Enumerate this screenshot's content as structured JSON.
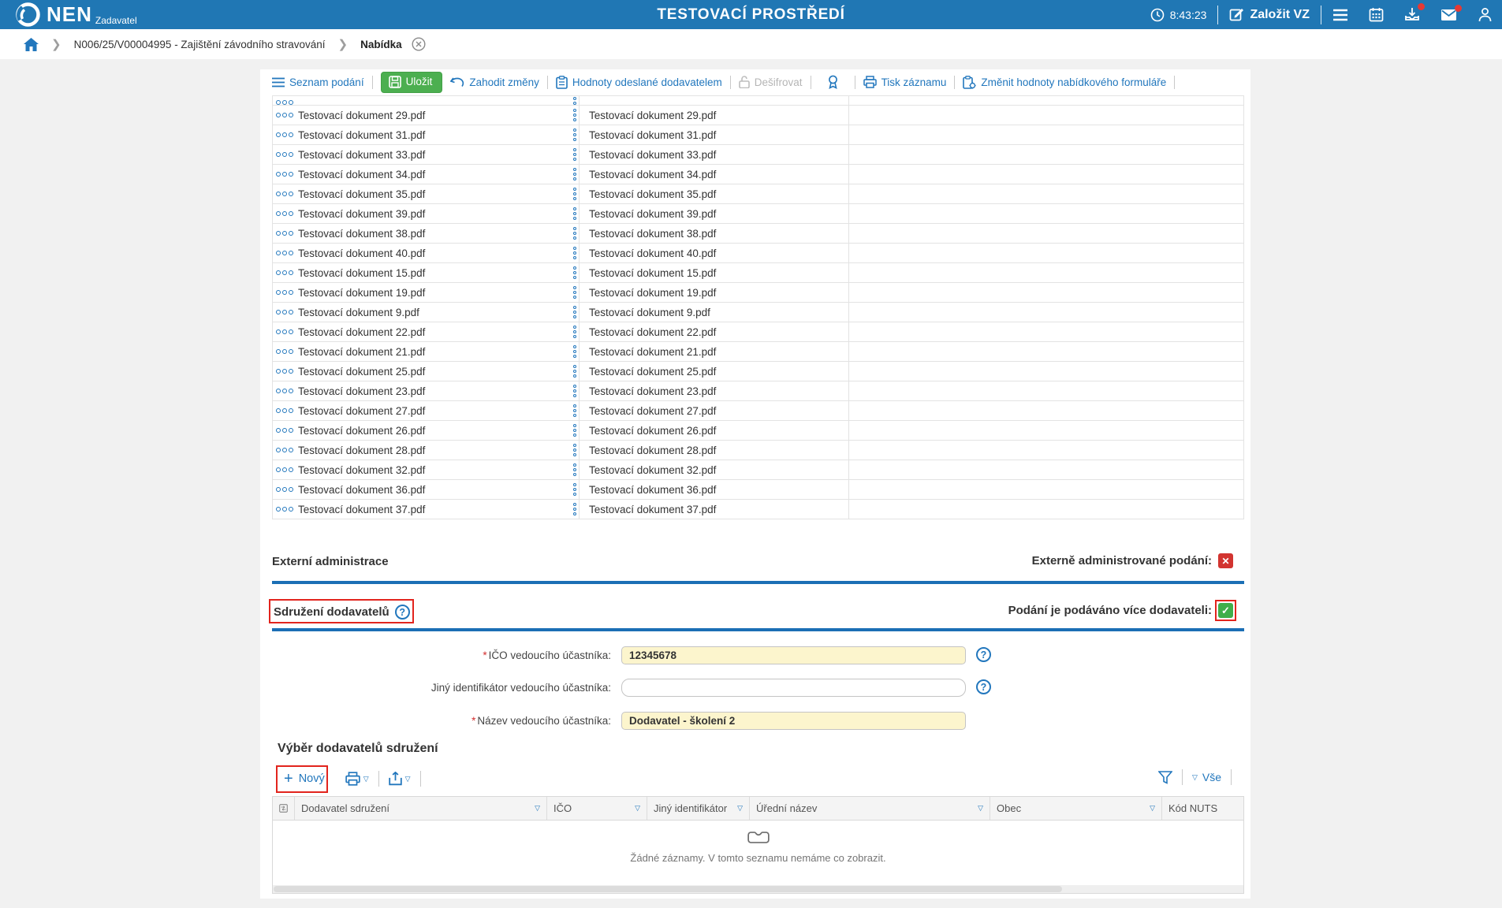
{
  "header": {
    "product": "NEN",
    "role": "Zadavatel",
    "environment": "TESTOVACÍ PROSTŘEDÍ",
    "time": "8:43:23",
    "create_vz_label": "Založit VZ"
  },
  "breadcrumb": {
    "path": "N006/25/V00004995 - Zajištění závodního stravování",
    "current": "Nabídka"
  },
  "toolbar": {
    "seznam_podani": "Seznam podání",
    "ulozit": "Uložit",
    "zahodit_zmeny": "Zahodit změny",
    "hodnoty_odeslane": "Hodnoty odeslané dodavatelem",
    "desifrovat": "Dešifrovat",
    "tisk_zaznamu": "Tisk záznamu",
    "zmenit_hodnoty": "Změnit hodnoty nabídkového formuláře"
  },
  "documents": {
    "rows": [
      "Testovací dokument 29.pdf",
      "Testovací dokument 31.pdf",
      "Testovací dokument 33.pdf",
      "Testovací dokument 34.pdf",
      "Testovací dokument 35.pdf",
      "Testovací dokument 39.pdf",
      "Testovací dokument 38.pdf",
      "Testovací dokument 40.pdf",
      "Testovací dokument 15.pdf",
      "Testovací dokument 19.pdf",
      "Testovací dokument 9.pdf",
      "Testovací dokument 22.pdf",
      "Testovací dokument 21.pdf",
      "Testovací dokument 25.pdf",
      "Testovací dokument 23.pdf",
      "Testovací dokument 27.pdf",
      "Testovací dokument 26.pdf",
      "Testovací dokument 28.pdf",
      "Testovací dokument 32.pdf",
      "Testovací dokument 36.pdf",
      "Testovací dokument 37.pdf"
    ]
  },
  "external_section": {
    "title": "Externí administrace",
    "label": "Externě administrované podání:",
    "checked": false
  },
  "association_section": {
    "title": "Sdružení dodavatelů",
    "label": "Podání je podáváno více dodavateli:",
    "checked": true,
    "fields": [
      {
        "label": "IČO vedoucího účastníka:",
        "required": true,
        "value": "12345678"
      },
      {
        "label": "Jiný identifikátor vedoucího účastníka:",
        "required": false,
        "value": ""
      },
      {
        "label": "Název vedoucího účastníka:",
        "required": true,
        "value": "Dodavatel - školení 2"
      }
    ]
  },
  "grid": {
    "title": "Výběr dodavatelů sdružení",
    "new_label": "Nový",
    "all_label": "Vše",
    "columns": [
      {
        "label": "Dodavatel sdružení",
        "filter": true
      },
      {
        "label": "IČO",
        "filter": true
      },
      {
        "label": "Jiný identifikátor",
        "filter": true
      },
      {
        "label": "Úřední název",
        "filter": true
      },
      {
        "label": "Obec",
        "filter": true
      },
      {
        "label": "Kód NUTS",
        "filter": false
      }
    ],
    "empty_text": "Žádné záznamy. V tomto seznamu nemáme co zobrazit."
  },
  "icons": {
    "clock": "clock outline",
    "edit": "pencil-square",
    "menu": "hamburger",
    "calendar": "calendar",
    "downloads": "download-tray with red badge",
    "mail": "envelope with red badge",
    "user": "person outline",
    "home": "blue house",
    "close_tab": "circled x",
    "row_menu": "three horizontal circles",
    "drag_dots": "three vertical circles",
    "help": "circled question mark",
    "filter": "funnel",
    "caret": "small down triangle",
    "empty_state": "empty tray"
  },
  "colors": {
    "topbar": "#2077b4",
    "link_blue": "#2277bd",
    "button_green": "#4caf50",
    "section_line": "#1b6fb5",
    "field_yellow": "#fcf5cd",
    "checkbox_red": "#d23430",
    "checkbox_green": "#3fae4a",
    "annotation_red": "#e2241d",
    "page_bg": "#f1f1f1"
  }
}
